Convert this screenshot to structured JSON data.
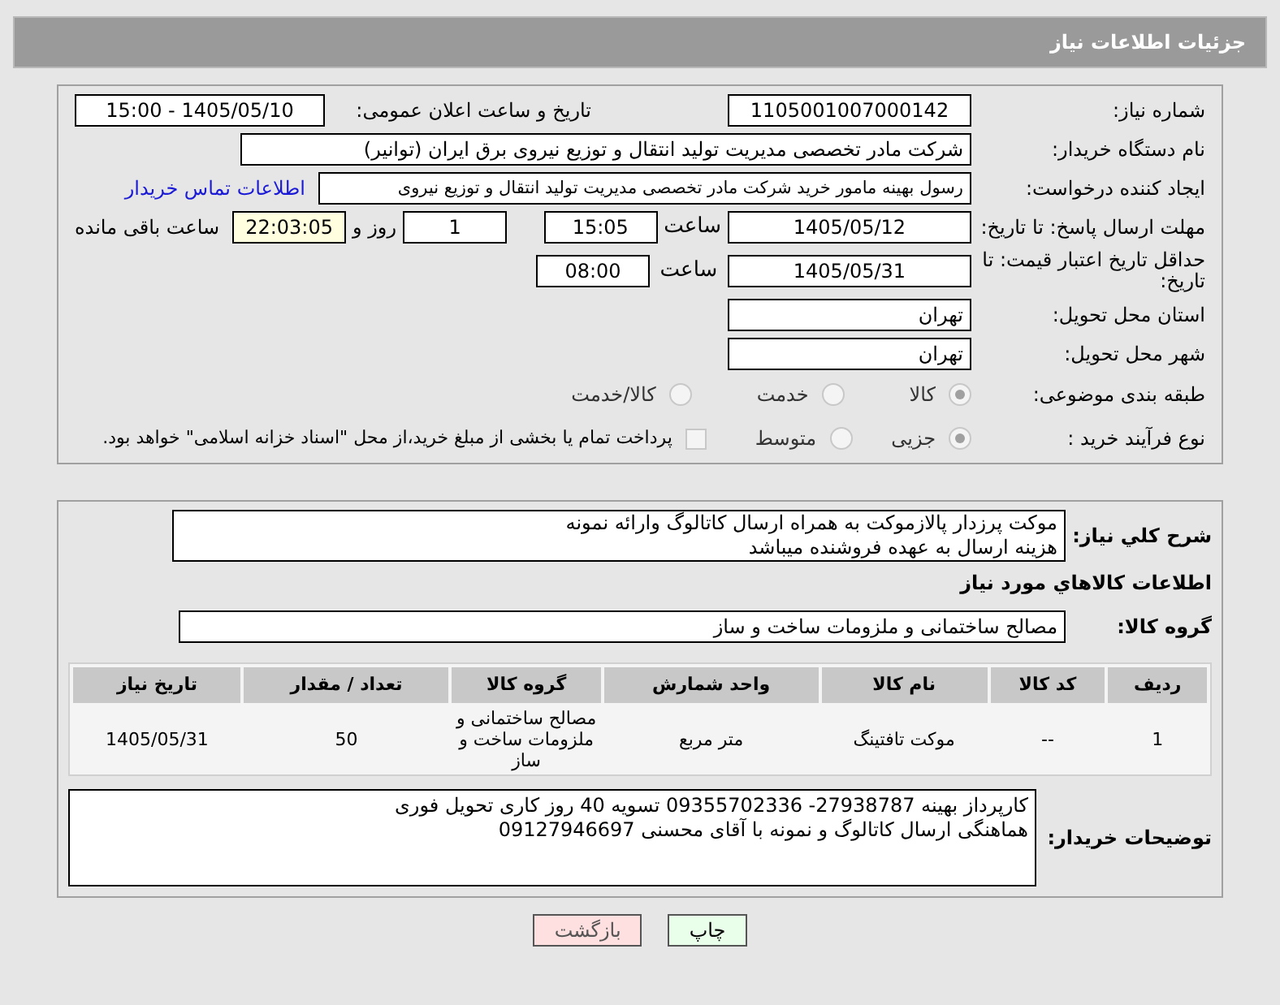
{
  "header": {
    "title": "جزئیات اطلاعات نیاز"
  },
  "need_number": {
    "label": "شماره نیاز:",
    "value": "1105001007000142"
  },
  "announce": {
    "label": "تاریخ و ساعت اعلان عمومی:",
    "value": "1405/05/10 - 15:00"
  },
  "buyer_org": {
    "label": "نام دستگاه خریدار:",
    "value": "شرکت مادر تخصصی مدیریت تولید  انتقال و توزیع نیروی برق ایران (توانیر)"
  },
  "creator": {
    "label": "ایجاد کننده درخواست:",
    "value": "رسول بهینه مامور خرید شرکت مادر تخصصی مدیریت تولید  انتقال و توزیع نیروی",
    "link": "اطلاعات تماس خریدار"
  },
  "deadline": {
    "label": "مهلت ارسال پاسخ: تا تاریخ:",
    "date": "1405/05/12",
    "time_label": "ساعت",
    "time": "15:05",
    "days": "1",
    "days_label": "روز و",
    "remaining": "22:03:05",
    "remaining_label": "ساعت باقی مانده"
  },
  "validity": {
    "label": "حداقل تاریخ اعتبار قیمت: تا تاریخ:",
    "date": "1405/05/31",
    "time_label": "ساعت",
    "time": "08:00"
  },
  "province": {
    "label": "استان محل تحویل:",
    "value": "تهران"
  },
  "city": {
    "label": "شهر محل تحویل:",
    "value": "تهران"
  },
  "category": {
    "label": "طبقه بندی موضوعی:",
    "options": [
      {
        "label": "کالا",
        "selected": true
      },
      {
        "label": "خدمت",
        "selected": false
      },
      {
        "label": "کالا/خدمت",
        "selected": false
      }
    ]
  },
  "process": {
    "label": "نوع فرآیند خرید :",
    "options": [
      {
        "label": "جزیی",
        "selected": true
      },
      {
        "label": "متوسط",
        "selected": false
      }
    ],
    "treasury": {
      "checked": false,
      "label": "پرداخت تمام یا بخشی از مبلغ خرید،از محل \"اسناد خزانه اسلامی\" خواهد بود."
    }
  },
  "description": {
    "label": "شرح کلي نياز:",
    "lines": [
      "موکت پرزدار پالازموکت به همراه ارسال کاتالوگ وارائه نمونه",
      "هزینه ارسال به عهده فروشنده میباشد"
    ]
  },
  "goods_heading": "اطلاعات کالاهاي مورد نياز",
  "goods_group": {
    "label": "گروه کالا:",
    "value": "مصالح ساختمانی و ملزومات ساخت و ساز"
  },
  "table": {
    "columns": [
      "ردیف",
      "کد کالا",
      "نام کالا",
      "واحد شمارش",
      "گروه کالا",
      "تعداد / مقدار",
      "تاریخ نیاز"
    ],
    "rows": [
      [
        "1",
        "--",
        "موکت تافتینگ",
        "متر مربع",
        "مصالح ساختمانی و ملزومات ساخت و ساز",
        "50",
        "1405/05/31"
      ]
    ]
  },
  "buyer_notes": {
    "label": "توضیحات خریدار:",
    "lines": [
      "کارپرداز بهینه 27938787- 09355702336 تسویه 40 روز کاری تحویل فوری",
      "هماهنگی ارسال کاتالوگ و نمونه با آقای محسنی 09127946697"
    ]
  },
  "buttons": [
    {
      "kind": "print",
      "label": "چاپ"
    },
    {
      "kind": "back",
      "label": "بازگشت"
    }
  ]
}
